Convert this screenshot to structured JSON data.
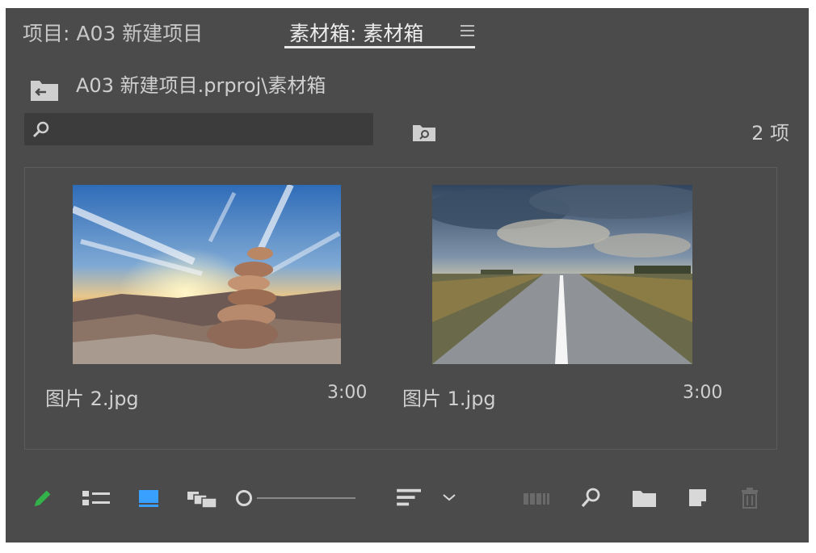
{
  "tabs": {
    "project": "项目: A03 新建项目",
    "bin": "素材箱: 素材箱"
  },
  "path": "A03 新建项目.prproj\\素材箱",
  "search": {
    "placeholder": ""
  },
  "item_count": "2 项",
  "clips": [
    {
      "name": "图片 2.jpg",
      "duration": "3:00"
    },
    {
      "name": "图片 1.jpg",
      "duration": "3:00"
    }
  ],
  "colors": {
    "panel": "#4b4b4b",
    "accent_blue": "#3aa0ff",
    "pencil_green": "#33b24a"
  },
  "zoom_slider": {
    "value": 0
  },
  "toolbar_icons": [
    "pencil-icon",
    "list-view-icon",
    "icon-view-icon",
    "freeform-view-icon",
    "zoom-slider",
    "sort-icon",
    "sort-dropdown-chevron-icon",
    "automate-to-sequence-icon",
    "find-icon",
    "new-bin-icon",
    "new-item-icon",
    "clear-trash-icon"
  ]
}
